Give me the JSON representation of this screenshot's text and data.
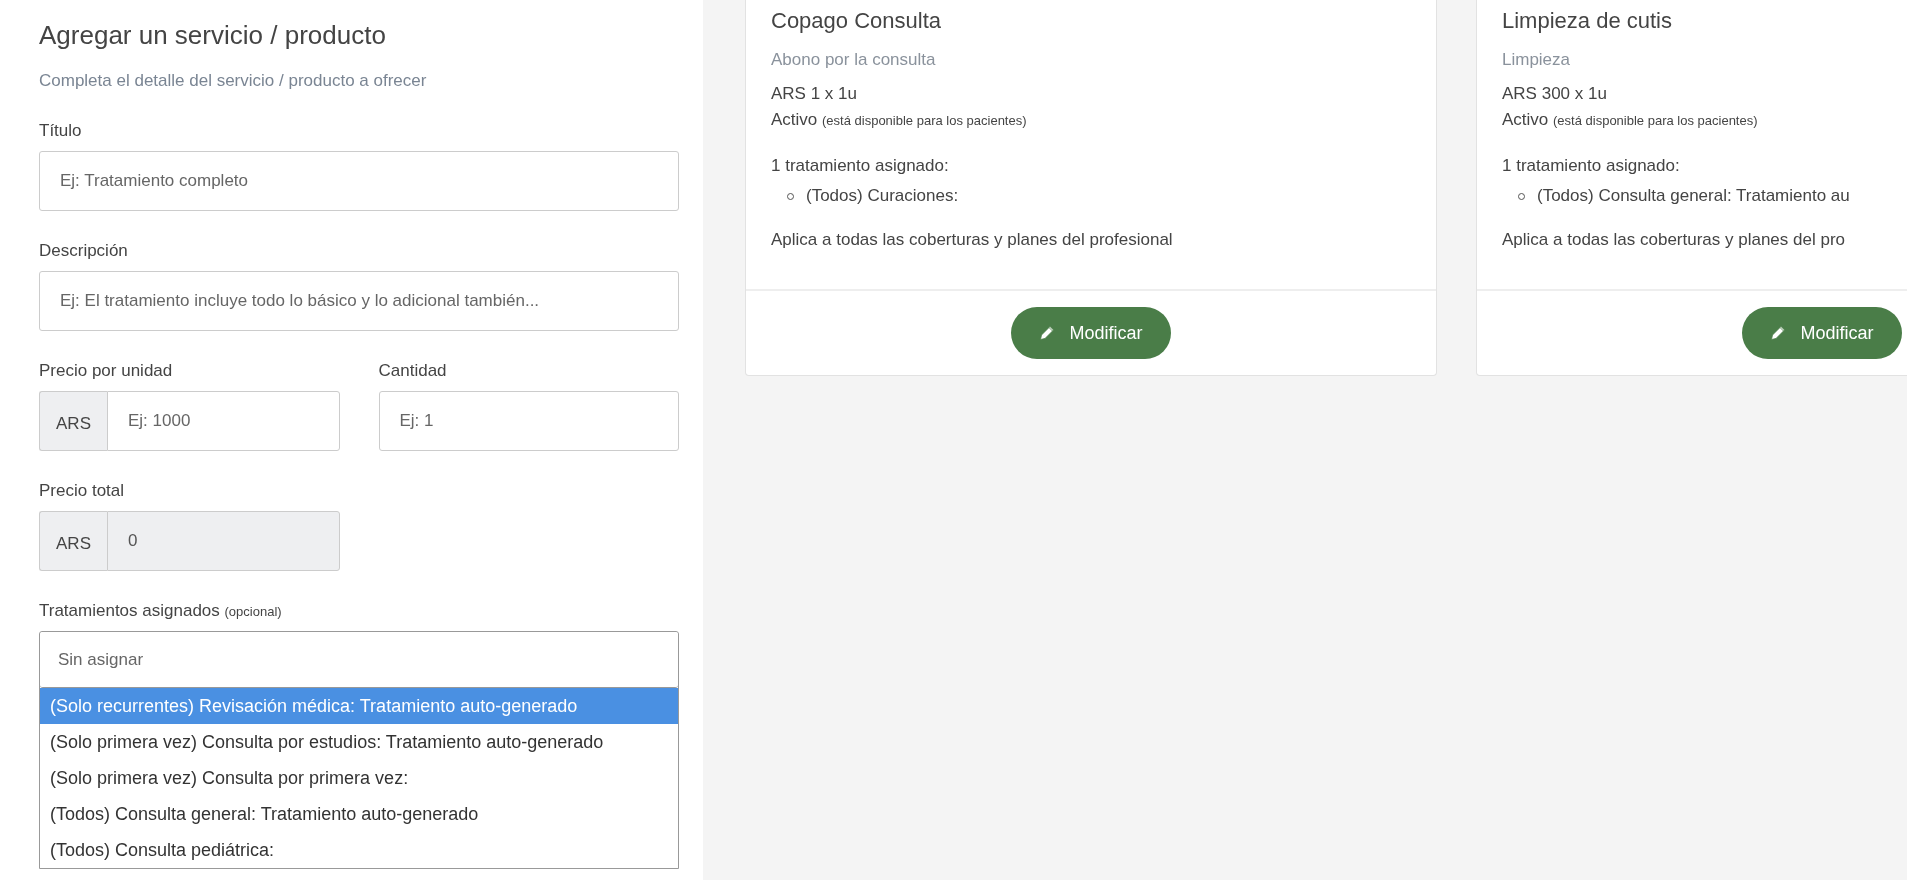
{
  "form": {
    "title": "Agregar un servicio / producto",
    "subtitle": "Completa el detalle del servicio / producto a ofrecer",
    "title_field": {
      "label": "Título",
      "placeholder": "Ej: Tratamiento completo"
    },
    "description_field": {
      "label": "Descripción",
      "placeholder": "Ej: El tratamiento incluye todo lo básico y lo adicional también..."
    },
    "unit_price_field": {
      "label": "Precio por unidad",
      "prefix": "ARS",
      "placeholder": "Ej: 1000"
    },
    "quantity_field": {
      "label": "Cantidad",
      "placeholder": "Ej: 1"
    },
    "total_field": {
      "label": "Precio total",
      "prefix": "ARS",
      "value": "0",
      "disabled": true
    },
    "treatments_field": {
      "label": "Tratamientos asignados",
      "label_note": "(opcional)",
      "placeholder": "Sin asignar",
      "options": [
        {
          "text": "(Solo recurrentes) Revisación médica: Tratamiento auto-generado",
          "selected": true
        },
        {
          "text": "(Solo primera vez) Consulta por estudios: Tratamiento auto-generado",
          "selected": false
        },
        {
          "text": "(Solo primera vez) Consulta por primera vez:",
          "selected": false
        },
        {
          "text": "(Todos) Consulta general: Tratamiento auto-generado",
          "selected": false
        },
        {
          "text": "(Todos) Consulta pediátrica:",
          "selected": false
        }
      ]
    }
  },
  "cards": [
    {
      "title": "Copago Consulta",
      "description": "Abono por la consulta",
      "price": "ARS 1 x 1u",
      "status": "Activo",
      "status_note": "(está disponible para los pacientes)",
      "treatments_heading": "1 tratamiento asignado:",
      "treatments": [
        "(Todos) Curaciones:"
      ],
      "coverage": "Aplica a todas las coberturas y planes del profesional",
      "button": "Modificar"
    },
    {
      "title": "Limpieza de cutis",
      "description": "Limpieza",
      "price": "ARS 300 x 1u",
      "status": "Activo",
      "status_note": "(está disponible para los pacientes)",
      "treatments_heading": "1 tratamiento asignado:",
      "treatments": [
        "(Todos) Consulta general: Tratamiento au"
      ],
      "coverage": "Aplica a todas las coberturas y planes del pro",
      "button": "Modificar"
    }
  ]
}
